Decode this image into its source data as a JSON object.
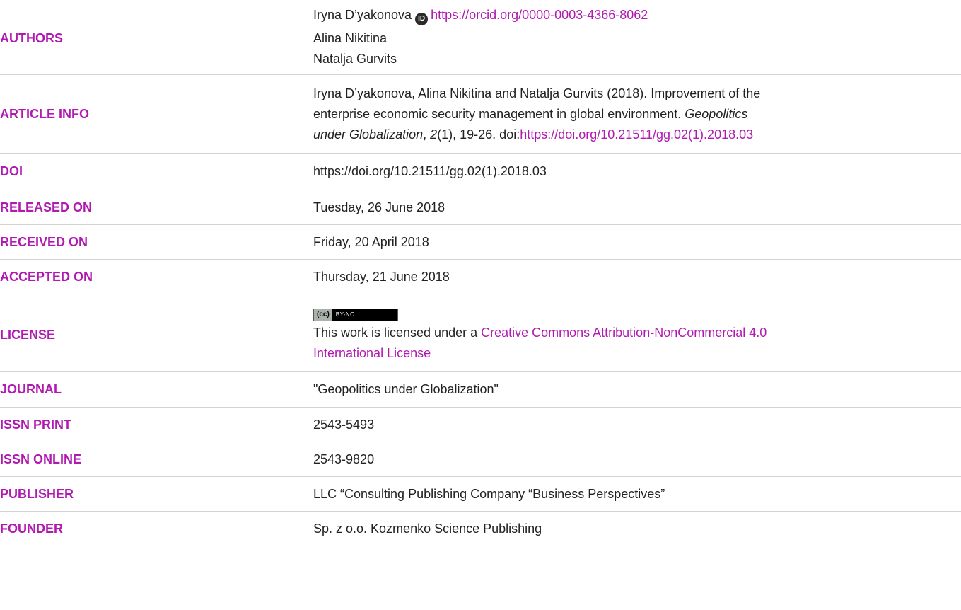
{
  "rows": {
    "authors": {
      "label": "AUTHORS",
      "authors": [
        "Iryna D’yakonova",
        "Alina Nikitina",
        "Natalja Gurvits"
      ],
      "orcid_icon": "ID",
      "orcid_url": "https://orcid.org/0000-0003-4366-8062"
    },
    "article_info": {
      "label": "ARTICLE INFO",
      "line1": "Iryna D’yakonova, Alina Nikitina and Natalja Gurvits (2018). Improvement of the",
      "line2_text": "enterprise economic security management in global environment. ",
      "line2_journal": "Geopolitics",
      "line3_journal": "under Globalization",
      "line3_sep": ", ",
      "line3_volume": "2",
      "line3_rest": "(1), 19-26. doi:",
      "line3_doi": "https://doi.org/10.21511/gg.02(1).2018.03"
    },
    "doi": {
      "label": "DOI",
      "value": "https://doi.org/10.21511/gg.02(1).2018.03"
    },
    "released": {
      "label": "RELEASED ON",
      "value": "Tuesday, 26 June 2018"
    },
    "received": {
      "label": "RECEIVED ON",
      "value": "Friday, 20 April 2018"
    },
    "accepted": {
      "label": "ACCEPTED ON",
      "value": "Thursday, 21 June 2018"
    },
    "license": {
      "label": "LICENSE",
      "badge_left": "(cc)",
      "badge_right": "BY-NC",
      "text": "This work is licensed under a ",
      "link_line1": "Creative Commons Attribution-NonCommercial 4.0",
      "link_line2": "International License"
    },
    "journal": {
      "label": "JOURNAL",
      "value": "\"Geopolitics under Globalization\""
    },
    "issn_print": {
      "label": "ISSN PRINT",
      "value": "2543-5493"
    },
    "issn_online": {
      "label": "ISSN ONLINE",
      "value": "2543-9820"
    },
    "publisher": {
      "label": "PUBLISHER",
      "value": "LLC “Consulting Publishing Company “Business Perspectives”"
    },
    "founder": {
      "label": "FOUNDER",
      "value": "Sp. z o.o. Kozmenko Science Publishing"
    }
  },
  "colors": {
    "label": "#b01ab0",
    "link": "#b01ab0",
    "text": "#222222",
    "divider": "#d2d2d2"
  }
}
